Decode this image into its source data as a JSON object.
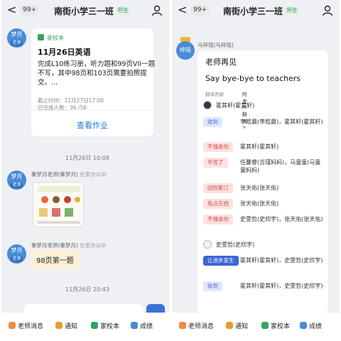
{
  "left": {
    "nav": {
      "back": "<",
      "badge": "99+",
      "title": "南街小学三一班",
      "role": "师生"
    },
    "homework": {
      "avatar_name": "梦月",
      "avatar_role": "老师",
      "tag": "家校本",
      "title": "11月26日英语",
      "body": "完成L10练习册，听力题和99页VII一题不写，其中98页和103页需要拍照提交。...",
      "deadline": "截止时间：11月27日17:00",
      "completed": "已完成人数：36 /56",
      "action": "查看作业"
    },
    "time1": "11月26日 10:08",
    "msg1": {
      "avatar_name": "梦月",
      "avatar_role": "老师",
      "sender": "秦梦月老师(秦梦月)",
      "office": "在家办公中"
    },
    "msg2": {
      "avatar_name": "梦月",
      "avatar_role": "老师",
      "sender": "秦梦月老师(秦梦月)",
      "office": "在家办公中",
      "text": "98页第一题"
    },
    "time2": "11月26日 20:43",
    "tabs": [
      "老师消息",
      "通知",
      "家校本",
      "成绩"
    ]
  },
  "right": {
    "nav": {
      "back": "<",
      "badge": "99+",
      "title": "南街小学三一班",
      "role": "师生"
    },
    "sender_avatar": "梓瑶",
    "sender": "马梓瑶(马梓瑶)",
    "notice_title": "老师再见",
    "notice_sub": "Say bye-bye to teachers",
    "translate_label": "翻译贡献",
    "translate_ai": "阿里AI翻译 >",
    "replies": [
      {
        "type": "icon",
        "text": "霍其轩(霍其轩)"
      },
      {
        "type": "pill",
        "pill": "收到",
        "pill_bg": "#dfe6fb",
        "pill_fg": "#4a68c9",
        "text": "李皓晨(李皓晨)，霍其轩(霍其轩)"
      },
      {
        "type": "pill",
        "pill": "不愧是你",
        "pill_bg": "#fde1e1",
        "pill_fg": "#d24a4a",
        "text": "霍其轩(霍其轩)"
      },
      {
        "type": "pill",
        "pill": "辛苦了",
        "pill_bg": "#fde1e1",
        "pill_fg": "#d24a4a",
        "text": "任馨睿(吉瑾妈妈)，马童童(马童童妈妈)"
      },
      {
        "type": "pill",
        "pill": "因吹斯汀",
        "pill_bg": "#fde1e1",
        "pill_fg": "#d24a4a",
        "text": "张天佑(张天佑)"
      },
      {
        "type": "pill",
        "pill": "有点东西",
        "pill_bg": "#fde1e1",
        "pill_fg": "#d24a4a",
        "text": "张天佑(张天佑)"
      },
      {
        "type": "pill",
        "pill": "不愧是你",
        "pill_bg": "#fde1e1",
        "pill_fg": "#d24a4a",
        "text": "史雯哲(史欣宇)，张天佑(张天佑)"
      },
      {
        "type": "icon2",
        "text": "史雯哲(史欣宇)"
      },
      {
        "type": "pill",
        "pill": "让进步发生",
        "pill_bg": "#3a66d4",
        "pill_fg": "#ffffff",
        "text": "霍其轩(霍其轩)，史雯哲(史欣宇)"
      },
      {
        "type": "pill",
        "pill": "收到",
        "pill_bg": "#dfe6fb",
        "pill_fg": "#4a68c9",
        "text": "霍其轩(霍其轩)，史雯哲(史欣宇)"
      }
    ],
    "tabs": [
      "老师消息",
      "通知",
      "家校本",
      "成绩"
    ]
  }
}
